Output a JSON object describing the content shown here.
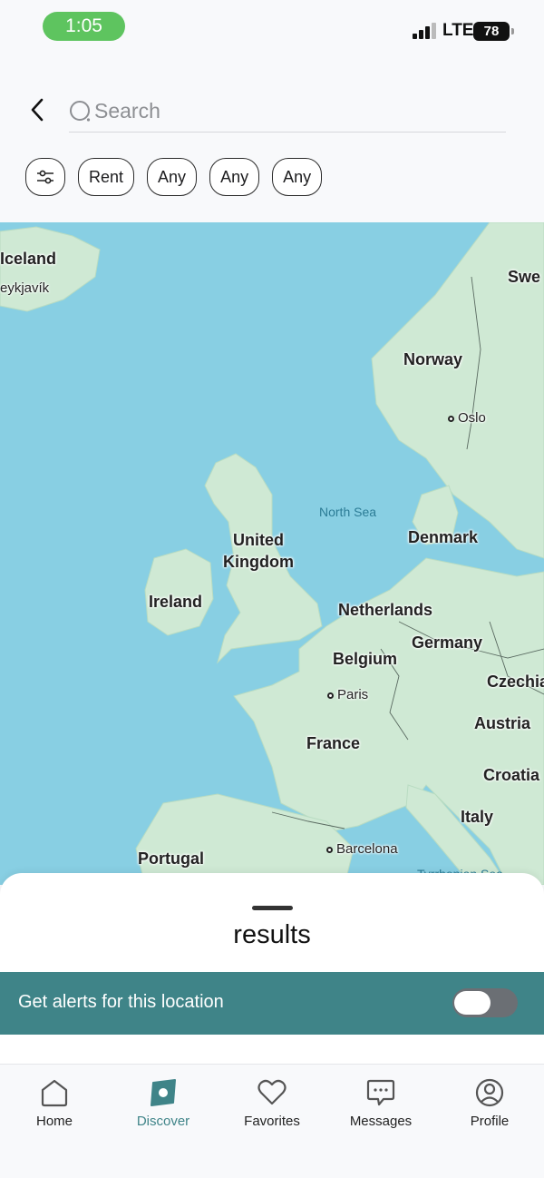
{
  "status_bar": {
    "time": "1:05",
    "network": "LTE",
    "battery": "78"
  },
  "search": {
    "placeholder": "Search"
  },
  "filters": {
    "chips": [
      "Rent",
      "Any",
      "Any",
      "Any"
    ]
  },
  "map": {
    "labels": {
      "iceland": "Iceland",
      "reykjavik": "eykjavík",
      "sweden": "Swe",
      "norway": "Norway",
      "oslo": "Oslo",
      "north_sea": "North Sea",
      "united_kingdom_1": "United",
      "united_kingdom_2": "Kingdom",
      "denmark": "Denmark",
      "ireland": "Ireland",
      "netherlands": "Netherlands",
      "belgium": "Belgium",
      "germany": "Germany",
      "czechia": "Czechia",
      "paris": "Paris",
      "austria": "Austria",
      "france": "France",
      "croatia": "Croatia",
      "italy": "Italy",
      "portugal": "Portugal",
      "barcelona": "Barcelona",
      "tyrrhenian_sea": "Tyrrhenian Sea"
    },
    "colors": {
      "water": "#88cfe3",
      "land": "#cfe9d4"
    }
  },
  "sheet": {
    "title": "results",
    "alert_label": "Get alerts for this location",
    "alert_enabled": false
  },
  "tabbar": {
    "active": "Discover",
    "items": [
      {
        "label": "Home",
        "icon": "home-icon"
      },
      {
        "label": "Discover",
        "icon": "discover-icon"
      },
      {
        "label": "Favorites",
        "icon": "heart-icon"
      },
      {
        "label": "Messages",
        "icon": "message-icon"
      },
      {
        "label": "Profile",
        "icon": "profile-icon"
      }
    ]
  },
  "colors": {
    "accent": "#3f8488",
    "status_pill": "#5ec45f"
  }
}
